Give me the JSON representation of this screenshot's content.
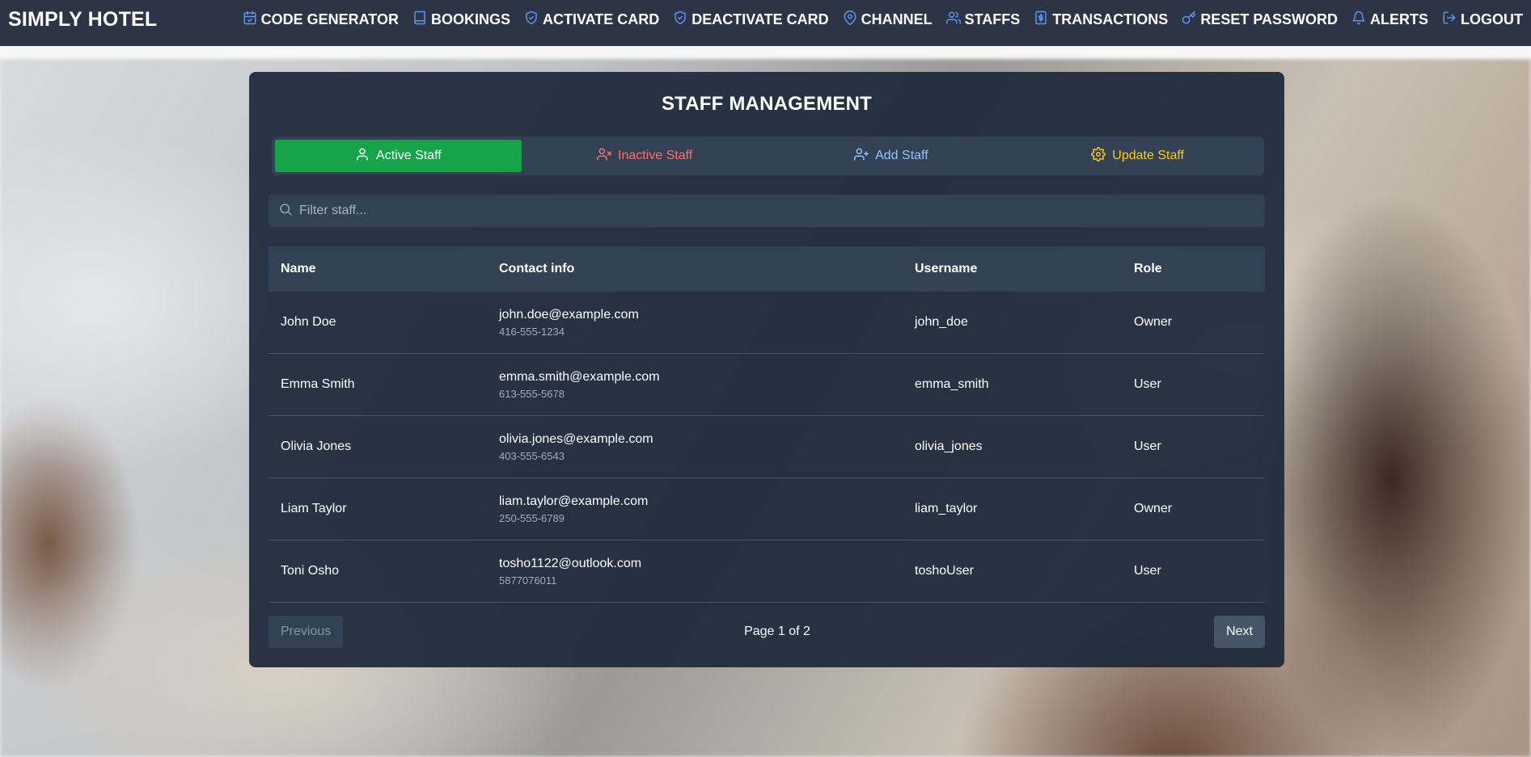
{
  "navbar": {
    "brand": "SIMPLY HOTEL",
    "links": [
      {
        "label": "CODE GENERATOR",
        "icon": "calendar-icon"
      },
      {
        "label": "BOOKINGS",
        "icon": "book-icon"
      },
      {
        "label": "ACTIVATE CARD",
        "icon": "shield-check-icon"
      },
      {
        "label": "DEACTIVATE CARD",
        "icon": "shield-icon"
      },
      {
        "label": "CHANNEL",
        "icon": "map-pin-icon"
      },
      {
        "label": "STAFFS",
        "icon": "users-icon"
      },
      {
        "label": "TRANSACTIONS",
        "icon": "receipt-icon"
      },
      {
        "label": "RESET PASSWORD",
        "icon": "key-icon"
      },
      {
        "label": "ALERTS",
        "icon": "bell-icon"
      },
      {
        "label": "LOGOUT",
        "icon": "logout-icon"
      }
    ],
    "accent": "#5b95ef"
  },
  "panel": {
    "title": "STAFF MANAGEMENT",
    "tabs": [
      {
        "label": "Active Staff",
        "icon": "user-icon"
      },
      {
        "label": "Inactive Staff",
        "icon": "user-x-icon"
      },
      {
        "label": "Add Staff",
        "icon": "user-plus-icon"
      },
      {
        "label": "Update Staff",
        "icon": "gear-icon"
      }
    ],
    "search": {
      "placeholder": "Filter staff...",
      "value": ""
    }
  },
  "table": {
    "columns": [
      "Name",
      "Contact info",
      "Username",
      "Role"
    ],
    "rows": [
      {
        "name": "John Doe",
        "email": "john.doe@example.com",
        "phone": "416-555-1234",
        "username": "john_doe",
        "role": "Owner"
      },
      {
        "name": "Emma Smith",
        "email": "emma.smith@example.com",
        "phone": "613-555-5678",
        "username": "emma_smith",
        "role": "User"
      },
      {
        "name": "Olivia Jones",
        "email": "olivia.jones@example.com",
        "phone": "403-555-6543",
        "username": "olivia_jones",
        "role": "User"
      },
      {
        "name": "Liam Taylor",
        "email": "liam.taylor@example.com",
        "phone": "250-555-6789",
        "username": "liam_taylor",
        "role": "Owner"
      },
      {
        "name": "Toni Osho",
        "email": "tosho1122@outlook.com",
        "phone": "5877076011",
        "username": "toshoUser",
        "role": "User"
      }
    ]
  },
  "pagination": {
    "previous_label": "Previous",
    "next_label": "Next",
    "page_info": "Page 1 of 2"
  },
  "colors": {
    "active_tab": "#16a34a",
    "inactive_tab": "#f87171",
    "add_tab": "#93c5fd",
    "update_tab": "#facc15"
  }
}
